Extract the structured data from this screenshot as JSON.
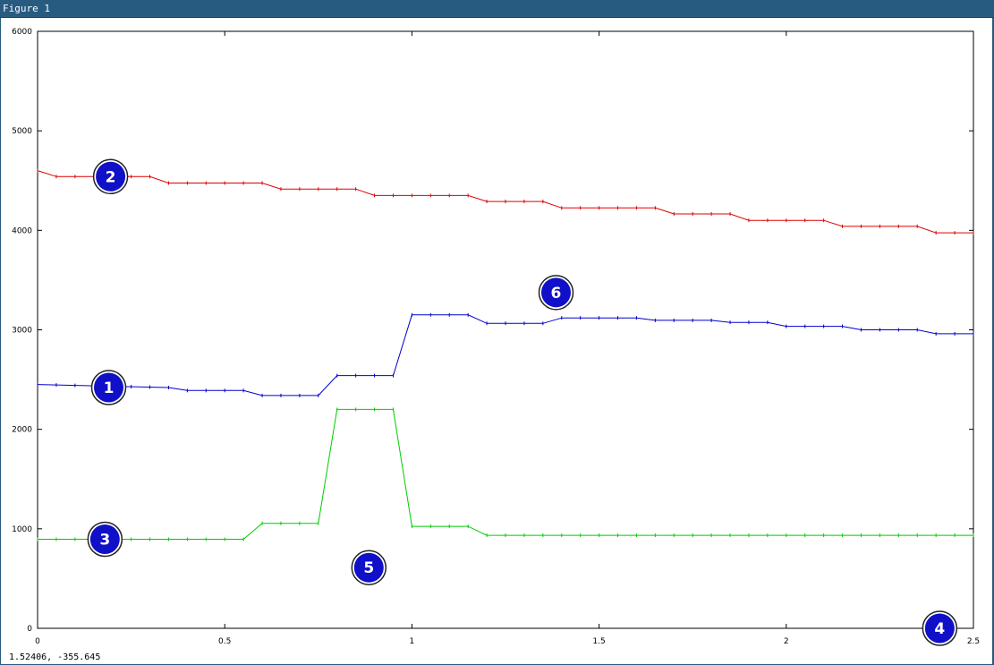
{
  "window": {
    "title": "Figure 1"
  },
  "status": {
    "coords": "1.52406, -355.645"
  },
  "chart_data": {
    "type": "line",
    "title": "",
    "xlabel": "",
    "ylabel": "",
    "xlim": [
      0,
      2.5
    ],
    "ylim": [
      0,
      6000
    ],
    "grid": false,
    "x_ticks": [
      0,
      0.5,
      1,
      1.5,
      2,
      2.5
    ],
    "x_tick_labels": [
      "0",
      "0.5",
      "1",
      "1.5",
      "2",
      "2.5"
    ],
    "y_ticks": [
      0,
      1000,
      2000,
      3000,
      4000,
      5000,
      6000
    ],
    "y_tick_labels": [
      "0",
      "1000",
      "2000",
      "3000",
      "4000",
      "5000",
      "6000"
    ],
    "series": [
      {
        "color": "#dd0000",
        "x": [
          0,
          0.05,
          0.3,
          0.35,
          0.6,
          0.65,
          0.85,
          0.9,
          1.15,
          1.2,
          1.35,
          1.4,
          1.65,
          1.7,
          1.85,
          1.9,
          2.1,
          2.15,
          2.35,
          2.4,
          2.5
        ],
        "y": [
          4600,
          4540,
          4540,
          4475,
          4475,
          4415,
          4415,
          4350,
          4350,
          4290,
          4290,
          4225,
          4225,
          4165,
          4165,
          4100,
          4100,
          4040,
          4040,
          3975,
          3975
        ]
      },
      {
        "color": "#0000cc",
        "x": [
          0,
          0.35,
          0.4,
          0.55,
          0.6,
          0.75,
          0.8,
          0.95,
          1.0,
          1.15,
          1.2,
          1.35,
          1.4,
          1.6,
          1.65,
          1.8,
          1.85,
          1.95,
          2.0,
          2.15,
          2.2,
          2.35,
          2.4,
          2.5
        ],
        "y": [
          2450,
          2420,
          2390,
          2390,
          2340,
          2340,
          2540,
          2540,
          3150,
          3150,
          3065,
          3065,
          3120,
          3120,
          3095,
          3095,
          3075,
          3075,
          3035,
          3035,
          3000,
          3000,
          2960,
          2960
        ]
      },
      {
        "color": "#00cc00",
        "x": [
          0,
          0.55,
          0.6,
          0.75,
          0.8,
          0.95,
          1.0,
          1.15,
          1.2,
          2.5
        ],
        "y": [
          895,
          895,
          1055,
          1055,
          2200,
          2200,
          1025,
          1025,
          935,
          935
        ]
      }
    ],
    "annotations": [
      {
        "label": "1",
        "x": 0.19,
        "y": 2420
      },
      {
        "label": "2",
        "x": 0.195,
        "y": 4540
      },
      {
        "label": "3",
        "x": 0.18,
        "y": 895
      },
      {
        "label": "4",
        "x": 2.41,
        "y": 0
      },
      {
        "label": "5",
        "x": 0.885,
        "y": 610
      },
      {
        "label": "6",
        "x": 1.385,
        "y": 3375
      }
    ],
    "marker_color": "#1010c8"
  }
}
